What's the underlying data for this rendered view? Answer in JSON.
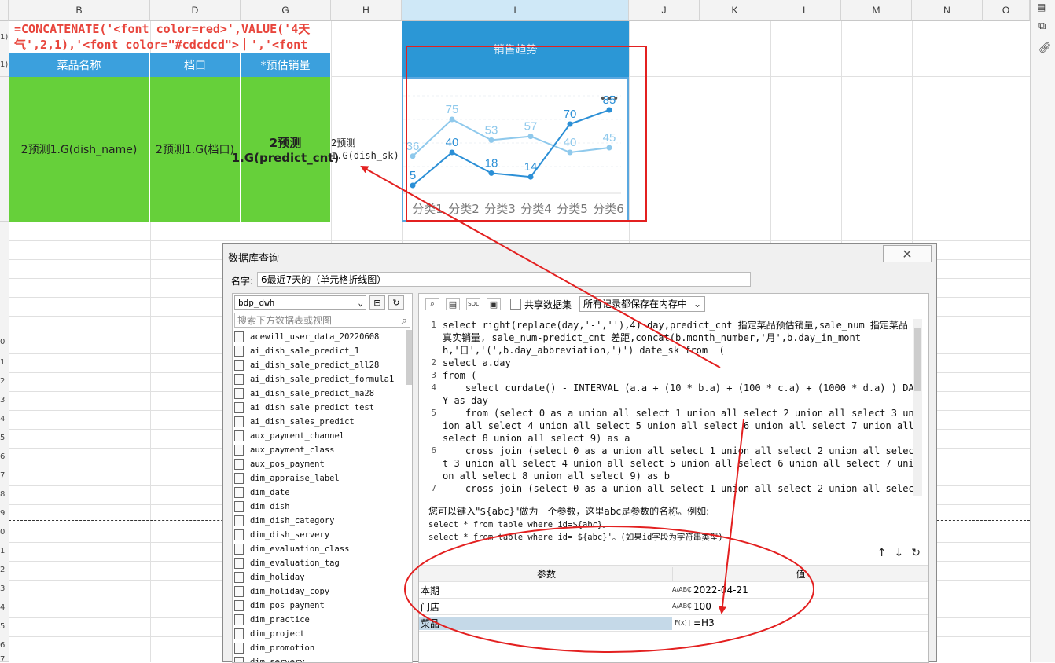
{
  "spreadsheet": {
    "columns": [
      {
        "label": "B"
      },
      {
        "label": "D"
      },
      {
        "label": "G"
      },
      {
        "label": "H"
      },
      {
        "label": "I"
      },
      {
        "label": "J"
      },
      {
        "label": "K"
      },
      {
        "label": "L"
      },
      {
        "label": "M"
      },
      {
        "label": "N"
      },
      {
        "label": "O"
      }
    ],
    "row_labels": [
      "1)",
      "1)",
      "0",
      "1",
      "2",
      "3",
      "4",
      "5",
      "6",
      "7",
      "8",
      "9",
      "0",
      "1",
      "2",
      "3",
      "4",
      "5",
      "6",
      "7"
    ],
    "formula_text": "=CONCATENATE('<font color=red>',VALUE('4天气',2,1),'<font color=\"#cdcdcd\">｜','<font",
    "headers": {
      "dish_name": "菜品名称",
      "stall": "档口",
      "predict_sales": "*预估销量",
      "chart": "销售趋势"
    },
    "cells": {
      "dish_name": "2预测1.G(dish_name)",
      "stall": "2预测1.G(档口)",
      "predict_cnt": "2预测1.G(predict_cnt)",
      "dish_sk": "2预测1.G(dish_sk)"
    }
  },
  "chart_data": {
    "type": "line",
    "categories": [
      "分类1",
      "分类2",
      "分类3",
      "分类4",
      "分类5",
      "分类6"
    ],
    "series": [
      {
        "values": [
          36,
          75,
          53,
          57,
          40,
          45
        ],
        "color": "#8fc9ec"
      },
      {
        "values": [
          5,
          40,
          18,
          14,
          70,
          85
        ],
        "color": "#2b8fd6"
      }
    ],
    "data_labels": [
      [
        "36",
        "75",
        "53",
        "57",
        "40",
        "45"
      ],
      [
        "5",
        "40",
        "18",
        "14",
        "70",
        "85"
      ]
    ],
    "more_label": "•••",
    "ylim": [
      0,
      100
    ]
  },
  "dialog": {
    "title": "数据库查询",
    "close": "✕",
    "name_label": "名字:",
    "name_value": "6最近7天的（单元格折线图）",
    "database": "bdp_dwh",
    "search_placeholder": "搜索下方数据表或视图",
    "tables": [
      "acewill_user_data_20220608",
      "ai_dish_sale_predict_1",
      "ai_dish_sale_predict_all28",
      "ai_dish_sale_predict_formula1",
      "ai_dish_sale_predict_ma28",
      "ai_dish_sale_predict_test",
      "ai_dish_sales_predict",
      "aux_payment_channel",
      "aux_payment_class",
      "aux_pos_payment",
      "dim_appraise_label",
      "dim_date",
      "dim_dish",
      "dim_dish_category",
      "dim_dish_servery",
      "dim_evaluation_class",
      "dim_evaluation_tag",
      "dim_holiday",
      "dim_holiday_copy",
      "dim_pos_payment",
      "dim_practice",
      "dim_project",
      "dim_promotion",
      "dim_servery"
    ],
    "toolbar": {
      "share_label": "共享数据集",
      "memory_label": "所有记录都保存在内存中"
    },
    "sql_lines": [
      {
        "no": "1",
        "text": "select right(replace(day,'-',''),4) day,predict_cnt 指定菜品预估销量,sale_num 指定菜品真实销量, sale_num-predict_cnt 差距,concat(b.month_number,'月',b.day_in_month,'日','(',b.day_abbreviation,')') date_sk from  ("
      },
      {
        "no": "2",
        "text": "select a.day"
      },
      {
        "no": "3",
        "text": "from ("
      },
      {
        "no": "4",
        "text": "    select curdate() - INTERVAL (a.a + (10 * b.a) + (100 * c.a) + (1000 * d.a) ) DAY as day"
      },
      {
        "no": "5",
        "text": "    from (select 0 as a union all select 1 union all select 2 union all select 3 union all select 4 union all select 5 union all select 6 union all select 7 union all select 8 union all select 9) as a"
      },
      {
        "no": "6",
        "text": "    cross join (select 0 as a union all select 1 union all select 2 union all select 3 union all select 4 union all select 5 union all select 6 union all select 7 union all select 8 union all select 9) as b"
      },
      {
        "no": "7",
        "text": "    cross join (select 0 as a union all select 1 union all select 2 union all select 3 union all select 4 union all select 5 union all select 6 union all select 7"
      }
    ],
    "hint": "您可以键入\"${abc}\"做为一个参数，这里abc是参数的名称。例如:",
    "hint_ex1": "select * from table where id=${abc}。",
    "hint_ex2": "select * from table where id='${abc}'。(如果id字段为字符串类型)",
    "params_header": {
      "name": "参数",
      "value": "值"
    },
    "params": [
      {
        "name": "本期",
        "type": "A/ABC",
        "value": "2022-04-21"
      },
      {
        "name": "门店",
        "type": "A/ABC",
        "value": "100"
      },
      {
        "name": "菜品",
        "type": "F(x)",
        "value": "=H3"
      }
    ]
  },
  "colors": {
    "header_blue": "#3ba0dd",
    "chart_title_blue": "#2b97d6",
    "cell_green": "#66d03a",
    "annotation_red": "#e32020",
    "formula_red": "#e8453c"
  }
}
